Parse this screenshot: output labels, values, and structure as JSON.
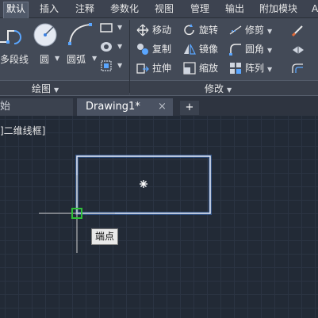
{
  "menu": {
    "tabs": [
      "默认",
      "插入",
      "注释",
      "参数化",
      "视图",
      "管理",
      "输出",
      "附加模块",
      "A"
    ]
  },
  "ribbon": {
    "draw_panel": {
      "title": "绘图",
      "tools": {
        "polyline": "多段线",
        "circle": "圆",
        "arc": "圆弧"
      }
    },
    "modify_panel": {
      "title": "修改",
      "tools": {
        "move": "移动",
        "rotate": "旋转",
        "trim": "修剪",
        "copy": "复制",
        "mirror": "镜像",
        "fillet": "圆角",
        "stretch": "拉伸",
        "scale": "缩放",
        "array": "阵列"
      }
    }
  },
  "file_tabs": {
    "start": "始",
    "current": "Drawing1*",
    "close_glyph": "×",
    "new_glyph": "+"
  },
  "drawing": {
    "viewport_label": "]二维线框]",
    "osnap_tooltip": "端点"
  },
  "colors": {
    "accent_selection": "#5b8cd8",
    "snap_marker": "#2fc03a",
    "crosshair": "#d0d0d0"
  }
}
